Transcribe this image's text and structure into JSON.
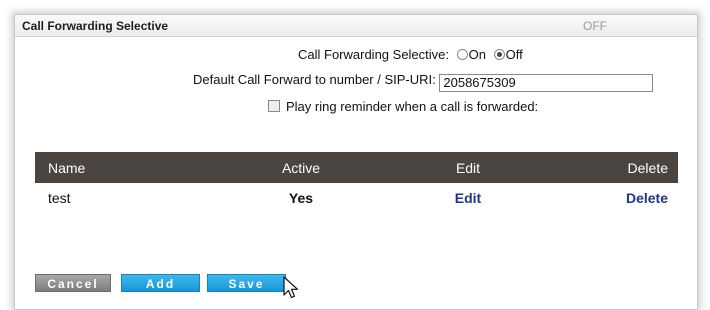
{
  "panel": {
    "title": "Call Forwarding Selective",
    "status": "OFF"
  },
  "form": {
    "selective_label": "Call Forwarding Selective:",
    "option_on": "On",
    "option_off": "Off",
    "selected": "Off",
    "forward_label": "Default Call Forward to number / SIP-URI:",
    "forward_value": "2058675309",
    "ring_reminder_label": "Play ring reminder when a call is forwarded:",
    "ring_reminder_checked": false
  },
  "table": {
    "headers": {
      "name": "Name",
      "active": "Active",
      "edit": "Edit",
      "delete": "Delete"
    },
    "rows": [
      {
        "name": "test",
        "active": "Yes",
        "edit": "Edit",
        "delete": "Delete"
      }
    ]
  },
  "buttons": {
    "cancel": "Cancel",
    "add": "Add",
    "save": "Save"
  },
  "icons": {
    "cursor": "mouse-pointer-icon"
  }
}
